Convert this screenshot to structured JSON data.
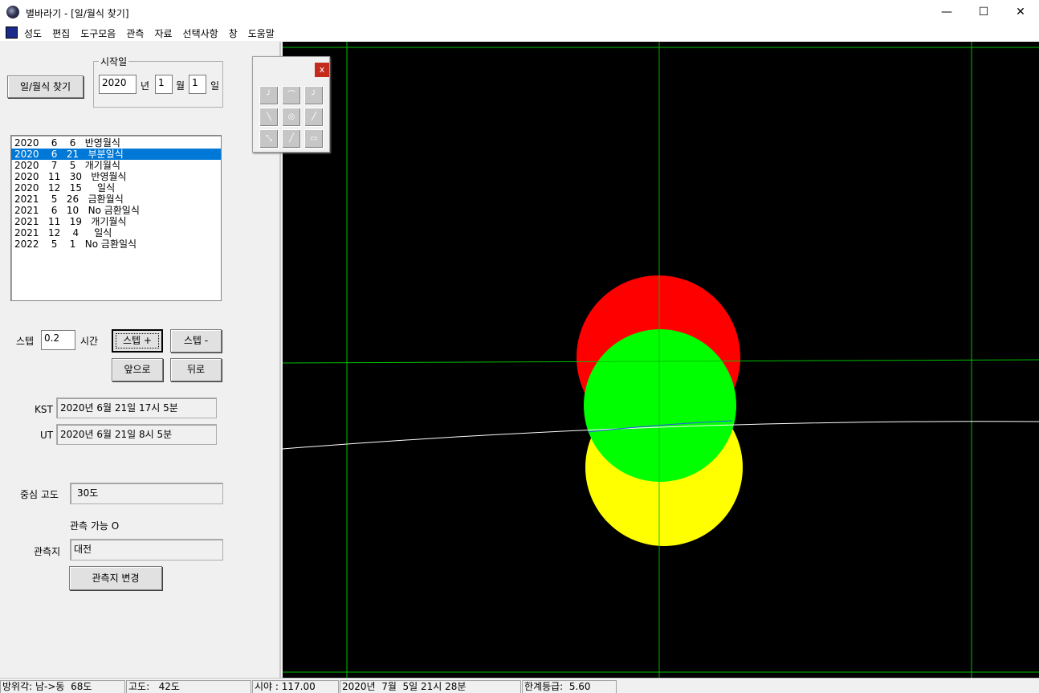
{
  "window": {
    "title": "별바라기 - [일/월식 찾기]",
    "minimize": "—",
    "maximize": "☐",
    "close": "✕"
  },
  "menu": {
    "items": [
      "성도",
      "편집",
      "도구모음",
      "관측",
      "자료",
      "선택사항",
      "창",
      "도움말"
    ],
    "mdi_minimize": "_",
    "mdi_restore": "🗗",
    "mdi_close": "✕"
  },
  "panel": {
    "find_button": "일/월식 찾기",
    "start_group_label": "시작일",
    "year_value": "2020",
    "year_unit": "년",
    "month_value": "1",
    "month_unit": "월",
    "day_value": "1",
    "day_unit": "일",
    "eclipses": [
      "2020    6    6   반영월식",
      "2020    6   21   부분일식",
      "2020    7    5   개기월식",
      "2020   11   30   반영월식",
      "2020   12   15     일식",
      "2021    5   26   금환월식",
      "2021    6   10   No 금환일식",
      "2021   11   19   개기월식",
      "2021   12    4     일식",
      "2022    5    1   No 금환일식"
    ],
    "selected_index": 1,
    "step_label": "스텝",
    "step_value": "0.2",
    "step_unit": "시간",
    "step_plus": "스텝 +",
    "step_minus": "스텝 -",
    "forward": "앞으로",
    "backward": "뒤로",
    "kst_label": "KST",
    "kst_value": "2020년   6월 21일 17시   5분",
    "ut_label": "UT",
    "ut_value": "2020년   6월 21일   8시   5분",
    "altitude_label": "중심 고도",
    "altitude_value": "30도",
    "observable_text": "관측 가능 O",
    "location_label": "관측지",
    "location_value": "대전",
    "change_location_button": "관측지 변경"
  },
  "palette": {
    "close": "x",
    "tools": [
      "tool-1",
      "tool-2",
      "tool-3",
      "tool-4",
      "tool-5",
      "tool-6",
      "tool-7",
      "tool-8",
      "tool-9"
    ]
  },
  "statusbar": {
    "azimuth": "방위각: 남->동  68도",
    "altitude": "고도:   42도",
    "fov": "시야 : 117.00",
    "datetime": "2020년  7월  5일 21시 28분",
    "limit_mag": "한계등급:  5.60"
  },
  "colors": {
    "sun": "#ff0000",
    "moon": "#00ff00",
    "eclipse_zone": "#ffff00",
    "grid": "#00c000",
    "horizon": "#ffffff",
    "selection": "#0078d7"
  }
}
